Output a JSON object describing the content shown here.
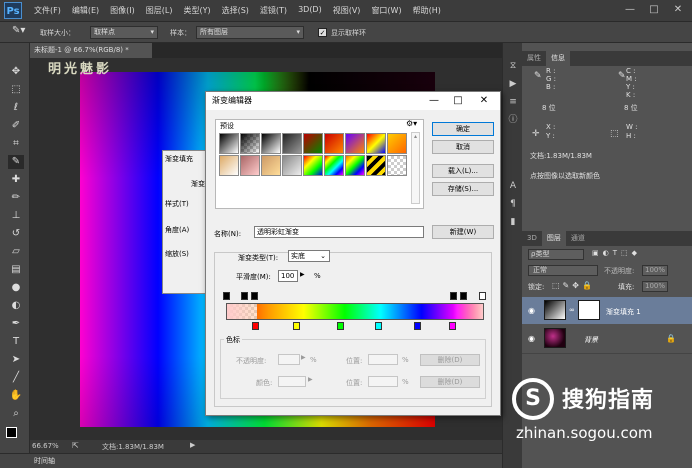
{
  "app": {
    "logo": "Ps",
    "watermark": "明光魅影"
  },
  "menu": [
    "文件(F)",
    "编辑(E)",
    "图像(I)",
    "图层(L)",
    "类型(Y)",
    "选择(S)",
    "滤镜(T)",
    "3D(D)",
    "视图(V)",
    "窗口(W)",
    "帮助(H)"
  ],
  "window_controls": {
    "minimize": "—",
    "restore": "□",
    "close": "✕"
  },
  "options": {
    "sample_size_label": "取样大小：",
    "sample_size_value": "取样点",
    "sample_label": "样本：",
    "sample_value": "所有图层",
    "show_ring_label": "显示取样环"
  },
  "document": {
    "tab_title": "未标题-1 @ 66.7%(RGB/8) *",
    "zoom": "66.67%",
    "doc_info": "文档:1.83M/1.83M"
  },
  "timeline_label": "时间轴",
  "info_panel": {
    "tabs": [
      "属性",
      "信息"
    ],
    "r": "R :",
    "g": "G :",
    "b": "B :",
    "c": "C :",
    "m": "M :",
    "y": "Y :",
    "k": "K :",
    "bits_left": "8 位",
    "bits_right": "8 位",
    "x": "X :",
    "y2": "Y :",
    "w": "W :",
    "h": "H :",
    "doc": "文档:1.83M/1.83M",
    "hint": "点按图像以选取新颜色"
  },
  "layers_panel": {
    "tabs": [
      "3D",
      "图层",
      "通道"
    ],
    "filter_label": "ρ类型",
    "blend_mode": "正常",
    "opacity_label": "不透明度:",
    "opacity_value": "100%",
    "lock_label": "锁定:",
    "fill_label": "填充:",
    "fill_value": "100%",
    "layers": [
      {
        "name": "渐变填充 1"
      },
      {
        "name": "背景"
      }
    ]
  },
  "gradient_fill_dialog": {
    "title": "渐变填充",
    "fields": [
      "渐变",
      "样式(T)",
      "角度(A)",
      "缩放(S)"
    ]
  },
  "gradient_editor": {
    "title": "渐变编辑器",
    "presets_label": "预设",
    "buttons": {
      "ok": "确定",
      "cancel": "取消",
      "load": "载入(L)...",
      "save": "存储(S)...",
      "new": "新建(W)"
    },
    "name_label": "名称(N):",
    "name_value": "透明彩虹渐变",
    "type_label": "渐变类型(T):",
    "type_value": "实底",
    "smooth_label": "平滑度(M):",
    "smooth_value": "100",
    "percent": "%",
    "stops_label": "色标",
    "opacity_label": "不透明度:",
    "location_label": "位置:",
    "delete_label": "删除(D)",
    "color_label": "颜色:"
  },
  "sogou": {
    "brand": "搜狗指南",
    "url": "zhinan.sogou.com",
    "logo_letter": "S"
  },
  "colors": {
    "accent": "#0078d7",
    "layer_selected": "#6a7d9a",
    "panel_bg": "#535353"
  }
}
